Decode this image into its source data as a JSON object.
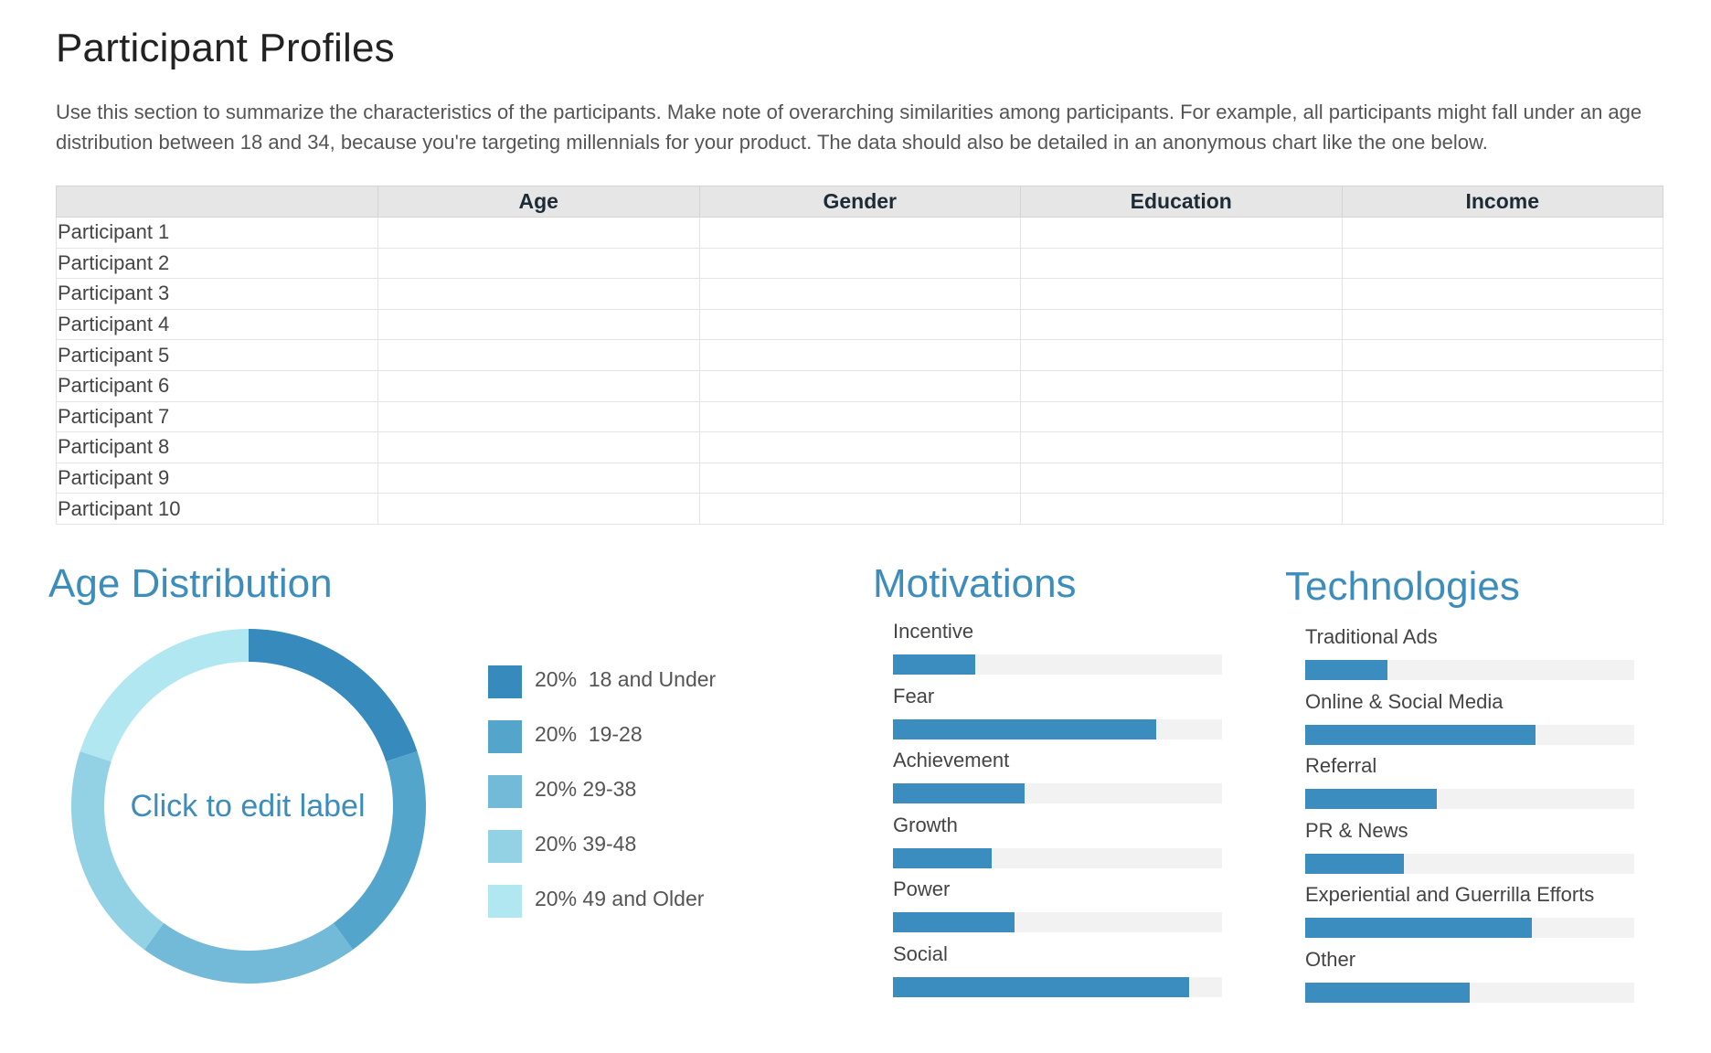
{
  "title": "Participant Profiles",
  "intro": "Use this section to summarize the characteristics of the participants. Make note of overarching similarities among participants. For example, all participants might fall under an age distribution between 18 and 34, because you're targeting millennials for your product. The data should also be detailed in an anonymous chart like the one below.",
  "table": {
    "headers": [
      "",
      "Age",
      "Gender",
      "Education",
      "Income"
    ],
    "rows": [
      "Participant 1",
      "Participant 2",
      "Participant 3",
      "Participant 4",
      "Participant 5",
      "Participant 6",
      "Participant 7",
      "Participant 8",
      "Participant 9",
      "Participant 10"
    ]
  },
  "age_distribution": {
    "heading": "Age Distribution",
    "center_label": "Click to edit label",
    "legend": [
      "20%  18 and Under",
      "20%  19-28",
      "20% 29-38",
      "20% 39-48",
      "20% 49 and Older"
    ]
  },
  "motivations": {
    "heading": "Motivations"
  },
  "technologies": {
    "heading": "Technologies"
  },
  "chart_data": [
    {
      "type": "pie",
      "categories": [
        "18 and Under",
        "19-28",
        "29-38",
        "39-48",
        "49 and Older"
      ],
      "values": [
        20,
        20,
        20,
        20,
        20
      ],
      "colors": [
        "#378abc",
        "#54a5cc",
        "#73b9d8",
        "#92d2e4",
        "#b1e7f0"
      ]
    },
    {
      "type": "bar",
      "categories": [
        "Incentive",
        "Fear",
        "Achievement",
        "Growth",
        "Power",
        "Social"
      ],
      "values": [
        25,
        80,
        40,
        30,
        37,
        90
      ],
      "ylim": [
        0,
        100
      ],
      "color": "#3a8dbe",
      "track_color": "#f2f2f2"
    },
    {
      "type": "bar",
      "categories": [
        "Traditional Ads",
        "Online & Social Media",
        "Referral",
        "PR & News",
        "Experiential and Guerrilla Efforts",
        "Other"
      ],
      "values": [
        25,
        70,
        40,
        30,
        69,
        50
      ],
      "ylim": [
        0,
        100
      ],
      "color": "#3a8dbe",
      "track_color": "#f2f2f2"
    }
  ]
}
